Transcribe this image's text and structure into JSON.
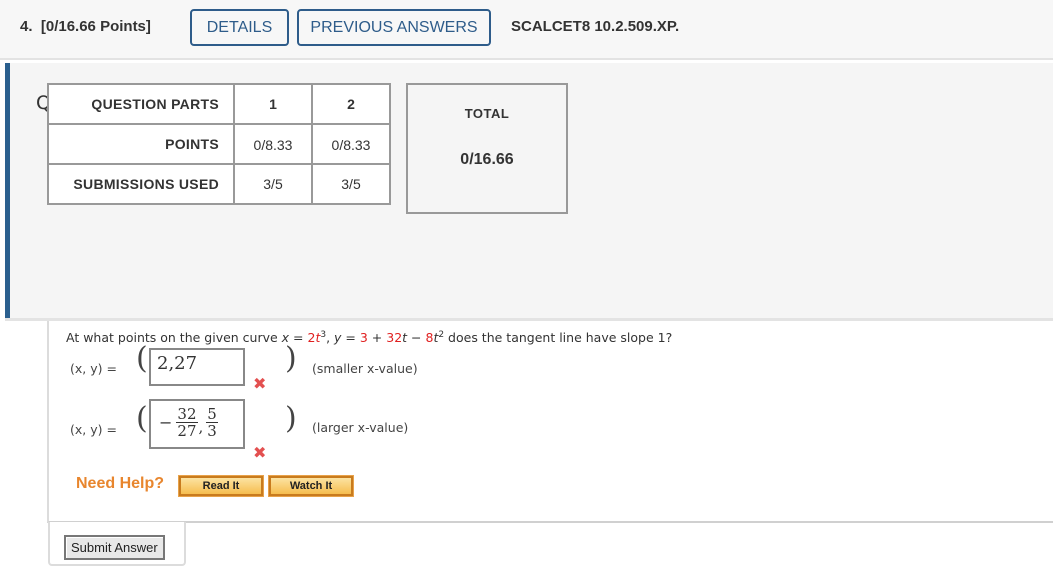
{
  "header": {
    "question_number": "4.",
    "points": "[0/16.66 Points]",
    "details_label": "DETAILS",
    "previous_answers_label": "PREVIOUS ANSWERS",
    "question_id": "SCALCET8 10.2.509.XP."
  },
  "details": {
    "title": "Question Details",
    "table": {
      "row_labels": [
        "QUESTION PARTS",
        "POINTS",
        "SUBMISSIONS USED"
      ],
      "parts": [
        "1",
        "2"
      ],
      "points": [
        "0/8.33",
        "0/8.33"
      ],
      "submissions": [
        "3/5",
        "3/5"
      ]
    },
    "total_label": "TOTAL",
    "total_value": "0/16.66"
  },
  "question": {
    "prefix": "At what points on the given curve ",
    "x_eq": "x = ",
    "x_coef": "2",
    "x_var": "t",
    "x_exp": "3",
    "sep": ", ",
    "y_eq": "y = ",
    "y_const": "3",
    "plus": " + ",
    "y_lin": "32",
    "y_var1": "t",
    "minus": " − ",
    "y_quad": "8",
    "y_var2": "t",
    "y_exp": "2",
    "suffix": "  does the tangent line have slope 1?",
    "answers": [
      {
        "label": "(x, y) = ",
        "value": "2,27",
        "hint": "(smaller x-value)",
        "status": "incorrect"
      },
      {
        "label": "(x, y) = ",
        "value_neg": "−",
        "value_frac1_num": "32",
        "value_frac1_den": "27",
        "value_frac2_num": "5",
        "value_frac2_den": "3",
        "hint": "(larger x-value)",
        "status": "incorrect"
      }
    ],
    "incorrect_mark": "✖",
    "need_help": "Need Help?",
    "read_it": "Read It",
    "watch_it": "Watch It"
  },
  "submit_label": "Submit Answer"
}
